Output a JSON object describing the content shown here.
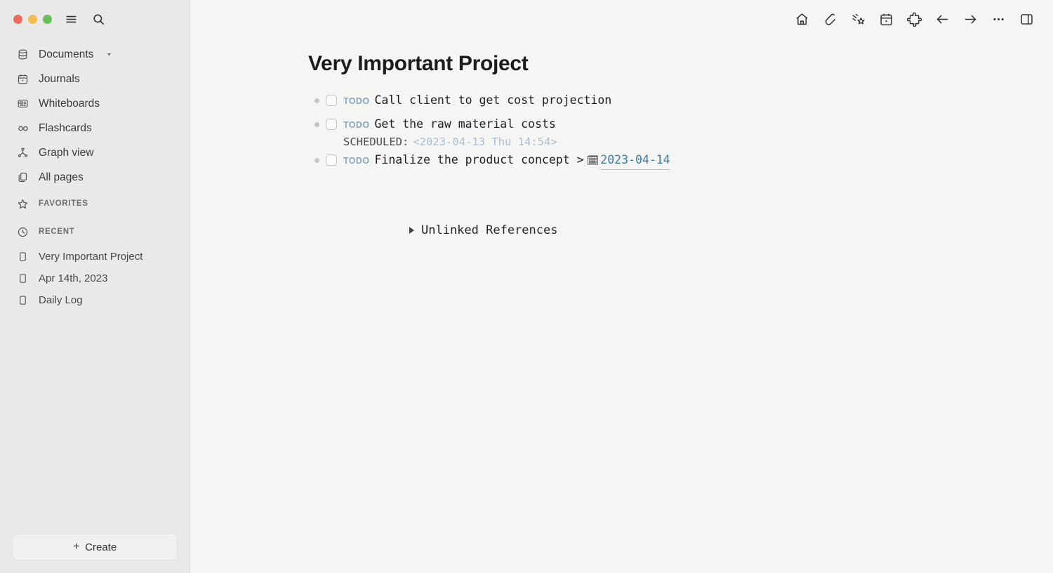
{
  "window": {
    "traffic_lights": [
      "close",
      "minimize",
      "maximize"
    ],
    "colors": {
      "close": "#ed6a5e",
      "minimize": "#f4bd4f",
      "maximize": "#61c454"
    }
  },
  "sidebar": {
    "menu_icon": "hamburger-icon",
    "search_icon": "search-icon",
    "nav": [
      {
        "label": "Documents",
        "icon": "database-icon",
        "has_caret": true
      },
      {
        "label": "Journals",
        "icon": "calendar-icon",
        "has_caret": false
      },
      {
        "label": "Whiteboards",
        "icon": "whiteboard-icon",
        "has_caret": false
      },
      {
        "label": "Flashcards",
        "icon": "infinity-icon",
        "has_caret": false
      },
      {
        "label": "Graph view",
        "icon": "graph-icon",
        "has_caret": false
      },
      {
        "label": "All pages",
        "icon": "pages-icon",
        "has_caret": false
      }
    ],
    "favorites": {
      "label": "FAVORITES",
      "icon": "star-icon",
      "items": []
    },
    "recent": {
      "label": "RECENT",
      "icon": "history-icon",
      "items": [
        {
          "label": "Very Important Project",
          "icon": "page-icon"
        },
        {
          "label": "Apr 14th, 2023",
          "icon": "page-icon"
        },
        {
          "label": "Daily Log",
          "icon": "page-icon"
        }
      ]
    },
    "create_button": {
      "label": "Create",
      "plus": "+"
    }
  },
  "toolbar": {
    "icons": [
      "home-icon",
      "pencil-icon",
      "shooting-star-icon",
      "calendar-icon",
      "puzzle-icon",
      "arrow-left-icon",
      "arrow-right-icon",
      "more-horizontal-icon",
      "sidebar-toggle-icon"
    ]
  },
  "page": {
    "title": "Very Important Project",
    "blocks": [
      {
        "marker": "TODO",
        "text": "Call client to get cost projection",
        "checked": false
      },
      {
        "marker": "TODO",
        "text": "Get the raw material costs",
        "checked": false,
        "scheduled_label": "SCHEDULED:",
        "scheduled_value": "<2023-04-13 Thu 14:54>"
      },
      {
        "marker": "TODO",
        "text": "Finalize the product concept >",
        "checked": false,
        "date_emoji": "🗓",
        "date_link": "2023-04-14"
      }
    ],
    "unlinked_references": {
      "label": "Unlinked References",
      "collapsed": true
    }
  },
  "colors": {
    "sidebar_bg": "#e9e9e7",
    "main_bg": "#f5f5f4",
    "todo_marker": "#8aa6bb",
    "scheduled_value": "#a9bfd0",
    "date_link": "#3d7b9e",
    "text": "#1f1e1c"
  }
}
